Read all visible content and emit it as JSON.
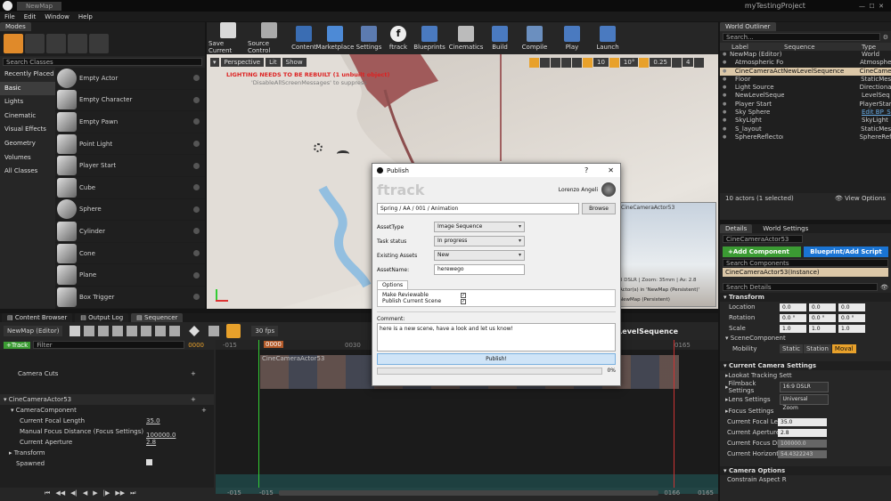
{
  "window": {
    "tab": "NewMap",
    "project": "myTestingProject"
  },
  "menu": [
    "File",
    "Edit",
    "Window",
    "Help"
  ],
  "modes": {
    "tab": "Modes",
    "search_placeholder": "Search Classes",
    "categories": [
      "Recently Placed",
      "Basic",
      "Lights",
      "Cinematic",
      "Visual Effects",
      "Geometry",
      "Volumes",
      "All Classes"
    ],
    "items": [
      "Empty Actor",
      "Empty Character",
      "Empty Pawn",
      "Point Light",
      "Player Start",
      "Cube",
      "Sphere",
      "Cylinder",
      "Cone",
      "Plane",
      "Box Trigger"
    ]
  },
  "toolbar": [
    "Save Current",
    "Source Control",
    "Content",
    "Marketplace",
    "Settings",
    "ftrack",
    "Blueprints",
    "Cinematics",
    "Build",
    "Compile",
    "Play",
    "Launch"
  ],
  "viewport": {
    "perspective": "Perspective",
    "lit": "Lit",
    "show": "Show",
    "warning": "LIGHTING NEEDS TO BE REBUILT (1 unbuilt object)",
    "warning2": "'DisableAllScreenMessages' to suppress",
    "grid": "10",
    "angle": "10°",
    "scale": "0.25",
    "cam": "4",
    "pip_title": "CineCameraActor53",
    "pip_info": "3 DSLR | Zoom: 35mm | Av: 2.8",
    "pip_info2": "Actor(s) in 'NewMap (Persistent)'",
    "pip_info3": "NewMap (Persistent)"
  },
  "outliner": {
    "tab": "World Outliner",
    "search_placeholder": "Search...",
    "cols": [
      "Label",
      "Sequence",
      "Type"
    ],
    "rows": [
      {
        "label": "NewMap (Editor)",
        "seq": "",
        "type": "World"
      },
      {
        "label": "Atmospheric Fog",
        "seq": "",
        "type": "Atmosphe"
      },
      {
        "label": "CineCameraActor53",
        "seq": "NewLevelSequence",
        "type": "CineCame"
      },
      {
        "label": "Floor",
        "seq": "",
        "type": "StaticMes"
      },
      {
        "label": "Light Source",
        "seq": "",
        "type": "Directiona"
      },
      {
        "label": "NewLevelSequer",
        "seq": "",
        "type": "LevelSeq"
      },
      {
        "label": "Player Start",
        "seq": "",
        "type": "PlayerStar"
      },
      {
        "label": "Sky Sphere",
        "seq": "",
        "type": "Edit BP_S"
      },
      {
        "label": "SkyLight",
        "seq": "",
        "type": "SkyLight"
      },
      {
        "label": "S_layout",
        "seq": "",
        "type": "StaticMes"
      },
      {
        "label": "SphereReflector",
        "seq": "",
        "type": "SphereRef"
      }
    ],
    "status": "10 actors (1 selected)",
    "view_options": "View Options"
  },
  "details": {
    "tab1": "Details",
    "tab2": "World Settings",
    "name": "CineCameraActor53",
    "add_component": "+Add Component",
    "blueprint": "Blueprint/Add Script",
    "search_components": "Search Components",
    "instance": "CineCameraActor53(Instance)",
    "search_details": "Search Details",
    "transform": "Transform",
    "location": "Location",
    "rotation": "Rotation",
    "scale": "Scale",
    "loc": [
      "0.0",
      "0.0",
      "0.0"
    ],
    "rot": [
      "0.0 °",
      "0.0 °",
      "0.0 °"
    ],
    "scl": [
      "1.0",
      "1.0",
      "1.0"
    ],
    "scene_component": "SceneComponent",
    "mobility": "Mobility",
    "mob": [
      "Static",
      "Station",
      "Moval"
    ],
    "cam_settings": "Current Camera Settings",
    "lookat": "Lookat Tracking Sett",
    "filmback": "Filmback Settings",
    "filmback_val": "16:9 DSLR",
    "lens": "Lens Settings",
    "lens_val": "Universal Zoom",
    "focus": "Focus Settings",
    "props": [
      {
        "k": "Current Focal Leng",
        "v": "35.0"
      },
      {
        "k": "Current Aperture",
        "v": "2.8"
      },
      {
        "k": "Current Focus Distan",
        "v": "100000.0"
      },
      {
        "k": "Current Horizontal FC",
        "v": "54.4322243"
      }
    ],
    "cam_options": "Camera Options",
    "constrain": "Constrain Aspect R"
  },
  "bottom_tabs": [
    "Content Browser",
    "Output Log",
    "Sequencer"
  ],
  "sequencer": {
    "map": "NewMap (Editor)",
    "fps": "30 fps",
    "seq_name": "NewLevelSequence",
    "track_btn": "+Track",
    "filter_placeholder": "Filter",
    "frame": "0000",
    "ticks": [
      "-015",
      "0000",
      "0030",
      "0165"
    ],
    "shot": "CineCameraActor53",
    "cuts": "Camera Cuts",
    "actor": "CineCameraActor53",
    "component": "CameraComponent",
    "props": [
      {
        "k": "Current Focal Length",
        "v": "35.0"
      },
      {
        "k": "Manual Focus Distance (Focus Settings)",
        "v": "100000.0"
      },
      {
        "k": "Current Aperture",
        "v": "2.8"
      }
    ],
    "transform": "Transform",
    "spawned": "Spawned",
    "range": [
      "-015",
      "-015",
      "0166",
      "0165"
    ]
  },
  "dialog": {
    "title": "Publish",
    "brand": "ftrack",
    "user": "Lorenzo Angeli",
    "context": "Spring / AA / 001 / Animation",
    "browse": "Browse",
    "fields": [
      {
        "k": "AssetType",
        "v": "Image Sequence"
      },
      {
        "k": "Task status",
        "v": "In progress"
      },
      {
        "k": "Existing Assets",
        "v": "New"
      }
    ],
    "asset_name_label": "AssetName:",
    "asset_name": "herewego",
    "options_tab": "Options",
    "options": [
      "Make Reviewable",
      "Publish Current Scene"
    ],
    "comment_label": "Comment:",
    "comment": "here is a new scene, have a look and let us know!",
    "publish": "Publish!",
    "progress": 0,
    "progress_text": "0%"
  },
  "colors": {
    "accent": "#e8a12b",
    "green": "#3b9b33",
    "blue": "#1a74d3",
    "select": "#dcc8a8"
  }
}
